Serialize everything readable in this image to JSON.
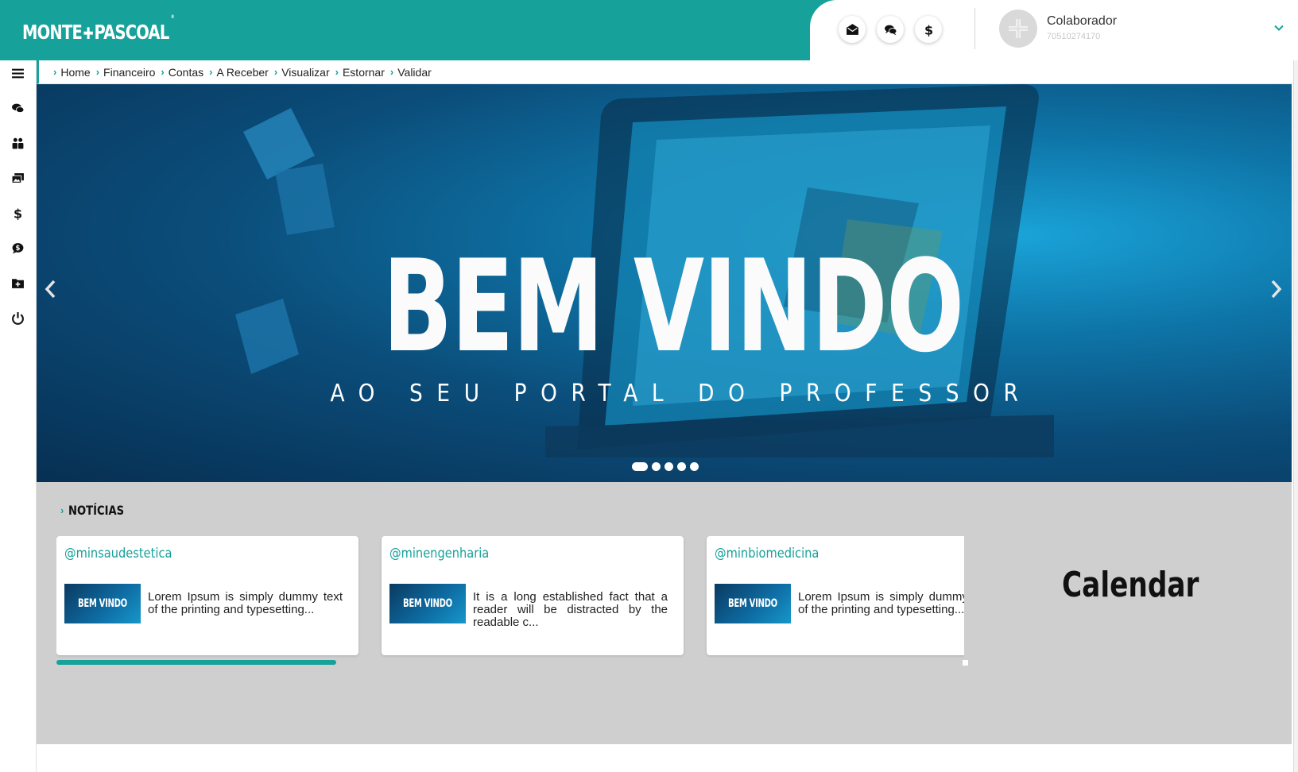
{
  "brand": {
    "logo_left": "MONTE",
    "logo_cross": "✚",
    "logo_right": "PASCOAL",
    "logo_mark": "®",
    "color": "#16a19a"
  },
  "header": {
    "icons": [
      "envelope-open-icon",
      "chat-bubbles-icon",
      "dollar-icon"
    ],
    "user": {
      "name": "Colaborador",
      "id": "70510274170"
    }
  },
  "sidebar": {
    "items": [
      "menu-icon",
      "comments-icon",
      "users-icon",
      "images-icon",
      "dollar-icon",
      "money-chat-icon",
      "folder-plus-icon",
      "power-icon"
    ]
  },
  "breadcrumb": [
    "Home",
    "Financeiro",
    "Contas",
    "A Receber",
    "Visualizar",
    "Estornar",
    "Validar"
  ],
  "hero": {
    "title": "BEM VINDO",
    "subtitle": "AO SEU PORTAL DO PROFESSOR",
    "slide_count": 5,
    "active_slide": 1
  },
  "news": {
    "heading": "NOTÍCIAS",
    "cards": [
      {
        "handle": "@minsaudestetica",
        "thumb": "BEM VINDO",
        "text": "Lorem Ipsum is simply dummy text of the printing and typesetting..."
      },
      {
        "handle": "@minengenharia",
        "thumb": "BEM VINDO",
        "text": "It is a long established fact that a reader will be distracted by the readable c..."
      },
      {
        "handle": "@minbiomedicina",
        "thumb": "BEM VINDO",
        "text": "Lorem Ipsum is simply dummy text of the printing and typesetting..."
      }
    ],
    "calendar_title": "Calendar"
  }
}
